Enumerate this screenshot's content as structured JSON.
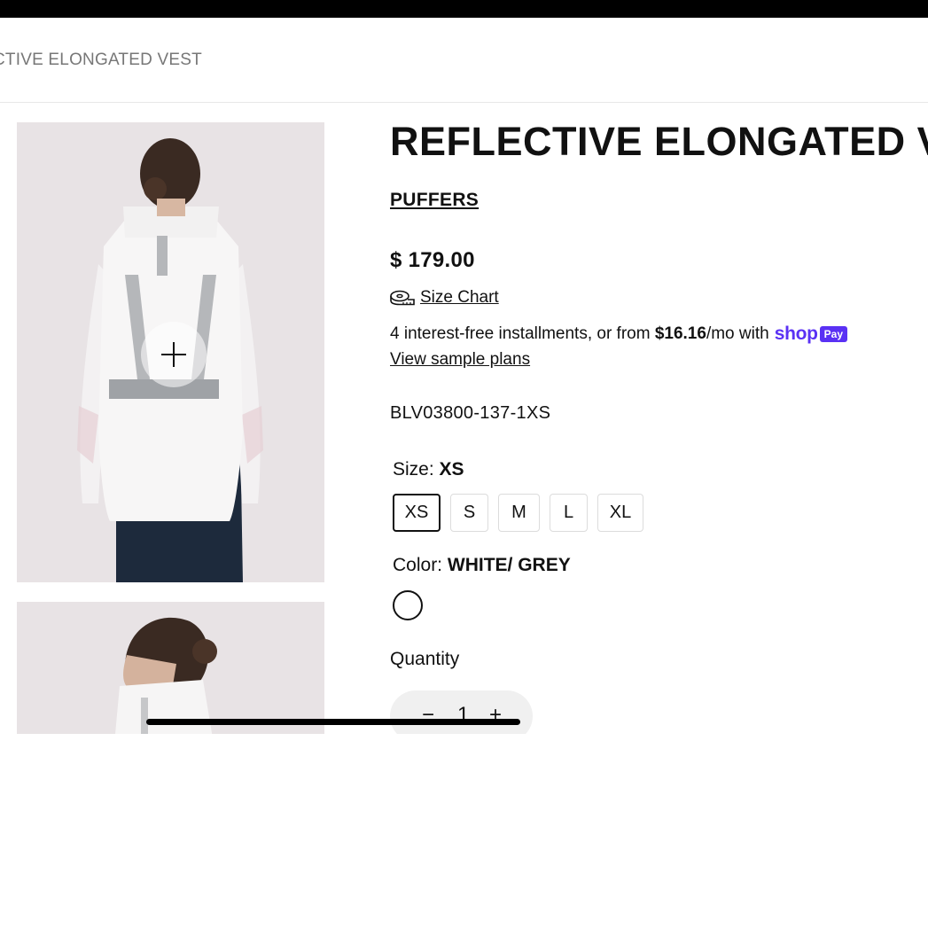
{
  "breadcrumb": {
    "current": "CTIVE ELONGATED VEST"
  },
  "product": {
    "title": "REFLECTIVE ELONGATED VEST",
    "collection": "PUFFERS",
    "price": "$ 179.00",
    "size_chart_label": "Size Chart",
    "installments": {
      "prefix": "4 interest-free installments, or from",
      "amount": "$16.16",
      "suffix": "/mo with",
      "brand": "shop",
      "badge": "Pay",
      "link": "View sample plans"
    },
    "sku": "BLV03800-137-1XS",
    "size": {
      "label": "Size:",
      "selected": "XS",
      "options": [
        "XS",
        "S",
        "M",
        "L",
        "XL"
      ]
    },
    "color": {
      "label": "Color:",
      "selected": "WHITE/ GREY",
      "swatch": "#ffffff"
    },
    "quantity": {
      "label": "Quantity",
      "minus": "−",
      "value": "1",
      "plus": "+"
    }
  },
  "colors": {
    "shop_pay": "#5a31f4",
    "photo_bg": "#e8e3e5"
  },
  "icons": {
    "size_chart": "tape-measure-icon",
    "zoom": "plus-icon"
  }
}
